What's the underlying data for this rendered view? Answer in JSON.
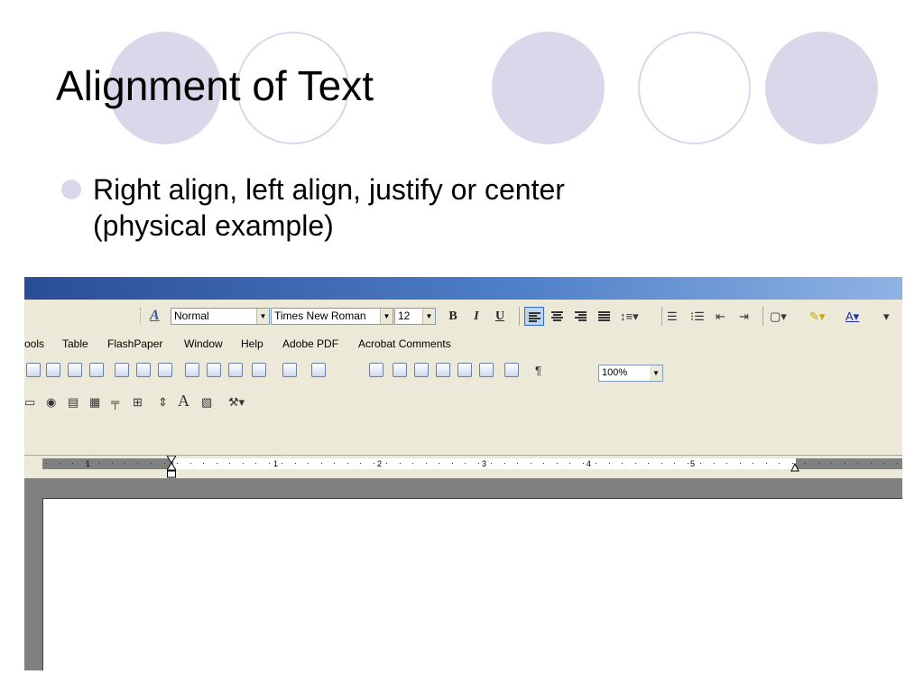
{
  "slide": {
    "title": "Alignment of Text",
    "bullet_line1": "Right align, left align, justify or center",
    "bullet_line2": "(physical example)"
  },
  "colors": {
    "accent_circle": "#d8d8ea",
    "titlebar_start": "#2a4d96",
    "titlebar_end": "#8fb3e4",
    "toolbar_bg": "#ece9d8"
  },
  "formatting": {
    "style": "Normal",
    "font": "Times New Roman",
    "size": "12",
    "bold": "B",
    "italic": "I",
    "underline": "U",
    "pilcrow": "¶"
  },
  "menu": [
    "Tools",
    "Table",
    "FlashPaper",
    "Window",
    "Help",
    "Adobe PDF",
    "Acrobat Comments"
  ],
  "menu_visible_first": "ools",
  "standard": {
    "zoom": "100%"
  },
  "forms_letter": "A",
  "ruler_numbers": [
    "1",
    "1",
    "2",
    "3",
    "4",
    "5"
  ]
}
